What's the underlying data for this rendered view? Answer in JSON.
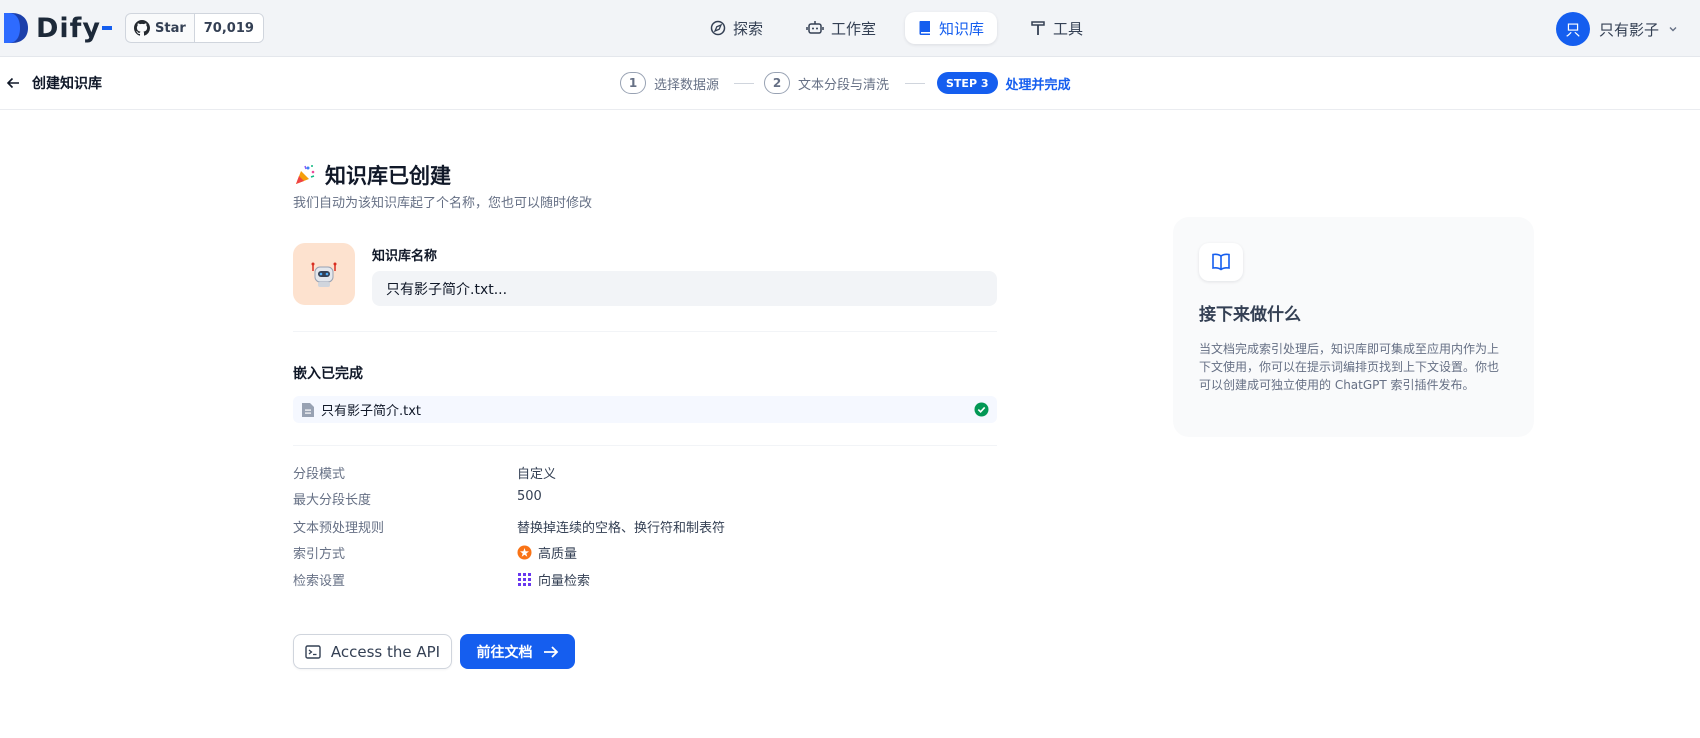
{
  "app": {
    "brand": "Dify",
    "github": {
      "star_label": "Star",
      "star_count": "70,019"
    }
  },
  "nav": {
    "items": [
      {
        "label": "探索",
        "icon": "compass-icon"
      },
      {
        "label": "工作室",
        "icon": "robot-icon"
      },
      {
        "label": "知识库",
        "icon": "book-icon",
        "active": true
      },
      {
        "label": "工具",
        "icon": "hammer-icon"
      }
    ]
  },
  "user": {
    "avatar_letter": "只",
    "name": "只有影子"
  },
  "header": {
    "back_label": "创建知识库",
    "steps": [
      {
        "num": "1",
        "label": "选择数据源"
      },
      {
        "num": "2",
        "label": "文本分段与清洗"
      },
      {
        "num": "STEP 3",
        "label": "处理并完成"
      }
    ]
  },
  "main": {
    "title": "知识库已创建",
    "subtitle": "我们自动为该知识库起了个名称，您也可以随时修改",
    "kb_name_label": "知识库名称",
    "kb_name_value": "只有影子简介.txt...",
    "embed_title": "嵌入已完成",
    "file_name": "只有影子简介.txt",
    "meta": [
      {
        "key": "分段模式",
        "value": "自定义"
      },
      {
        "key": "最大分段长度",
        "value": "500"
      },
      {
        "key": "文本预处理规则",
        "value": "替换掉连续的空格、换行符和制表符"
      },
      {
        "key": "索引方式",
        "value": "高质量"
      },
      {
        "key": "检索设置",
        "value": "向量检索"
      }
    ],
    "btn_api": "Access the API",
    "btn_doc": "前往文档"
  },
  "side": {
    "title": "接下来做什么",
    "text": "当文档完成索引处理后，知识库即可集成至应用内作为上下文使用，你可以在提示词编排页找到上下文设置。你也可以创建成可独立使用的 ChatGPT 索引插件发布。"
  },
  "colors": {
    "accent": "#155eef",
    "success": "#039855",
    "quality": "#f97316",
    "vector": "#6938ef"
  }
}
